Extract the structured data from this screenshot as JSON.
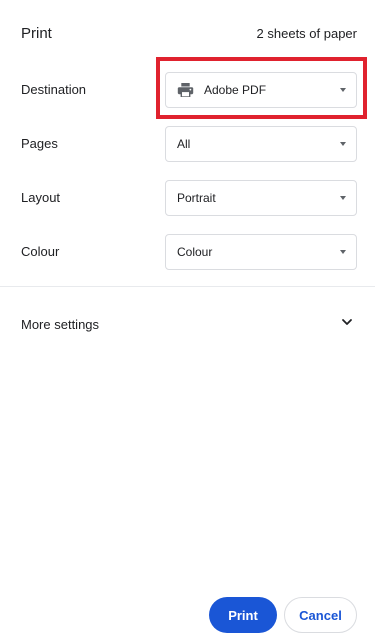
{
  "header": {
    "title": "Print",
    "sheets": "2 sheets of paper"
  },
  "settings": {
    "destination": {
      "label": "Destination",
      "value": "Adobe PDF",
      "icon": "printer-icon"
    },
    "pages": {
      "label": "Pages",
      "value": "All"
    },
    "layout": {
      "label": "Layout",
      "value": "Portrait"
    },
    "colour": {
      "label": "Colour",
      "value": "Colour"
    }
  },
  "more_settings": {
    "label": "More settings",
    "icon": "chevron-down-icon"
  },
  "actions": {
    "print_label": "Print",
    "cancel_label": "Cancel"
  },
  "colors": {
    "accent": "#1a56d6",
    "highlight": "#e0222e"
  }
}
